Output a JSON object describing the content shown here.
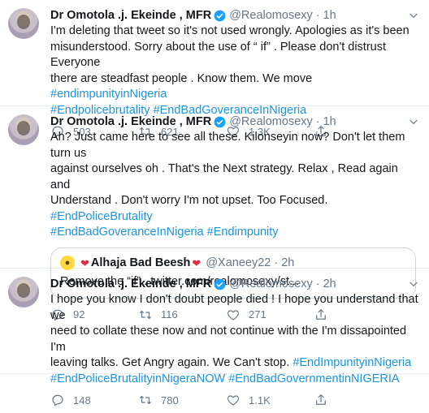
{
  "tweets": [
    {
      "name": "Dr Omotola .j. Ekeinde , MFR",
      "handle": "@Realomosexy",
      "dot": "·",
      "time": "1h",
      "lines": [
        "I'm deleting that tweet so it's not used wrongly. Apologies as it's been",
        "misunderstood.  Sorry about the use of “ if” .  Please don't distrust Everyone",
        "there are steadfast people . Know them. We move "
      ],
      "hashtags": [
        "#endimpunityinNigeria",
        "#Endpolicebrutality",
        "#EndBadGoveranceInNigeria"
      ],
      "replies": "503",
      "retweets": "621",
      "likes": "1.3K"
    },
    {
      "name": "Dr Omotola .j. Ekeinde , MFR",
      "handle": "@Realomosexy",
      "dot": "·",
      "time": "1h",
      "lines": [
        "Ah? Just came here to see all these. Kilonseyin now? Don't let them turn us",
        "against ourselves oh . That's the Next strategy. Relax , Read again and",
        "Understand . Don't worry I'm not upset. Too Focused. "
      ],
      "hashtags": [
        "#EndPoliceBrutality",
        "#EndBadGoveranceInNigeria",
        "#Endimpunity"
      ],
      "quote": {
        "name": "Alhaja Bad Beesh",
        "handle": "@Xaneey22",
        "dot": "·",
        "time": "2h",
        "text": "Remove the “if” . twitter.com/realomosexy/st..."
      },
      "replies": "92",
      "retweets": "116",
      "likes": "271"
    },
    {
      "name": "Dr Omotola .j. Ekeinde , MFR",
      "handle": "@Realomosexy",
      "dot": "·",
      "time": "2h",
      "lines": [
        "I hope you know I don't doubt  people died ! I hope you understand that we",
        "need to collate these now and not continue with the I'm dissapointed I'm",
        "leaving talks. Get Angry again. We Can't stop. "
      ],
      "hashtags": [
        "#EndImpunityinNigeria",
        "#EndPoliceBrutalityinNigeraNOW",
        "#EndBadGovernmentinNIGERIA"
      ],
      "replies": "148",
      "retweets": "780",
      "likes": "1.1K"
    }
  ],
  "icons": {
    "verified": "verified-badge-icon",
    "caret": "chevron-down-icon",
    "reply": "reply-icon",
    "retweet": "retweet-icon",
    "like": "heart-icon",
    "share": "share-icon"
  },
  "colors": {
    "link": "#1b95e0",
    "muted": "#657786",
    "verified": "#1da1f2"
  }
}
